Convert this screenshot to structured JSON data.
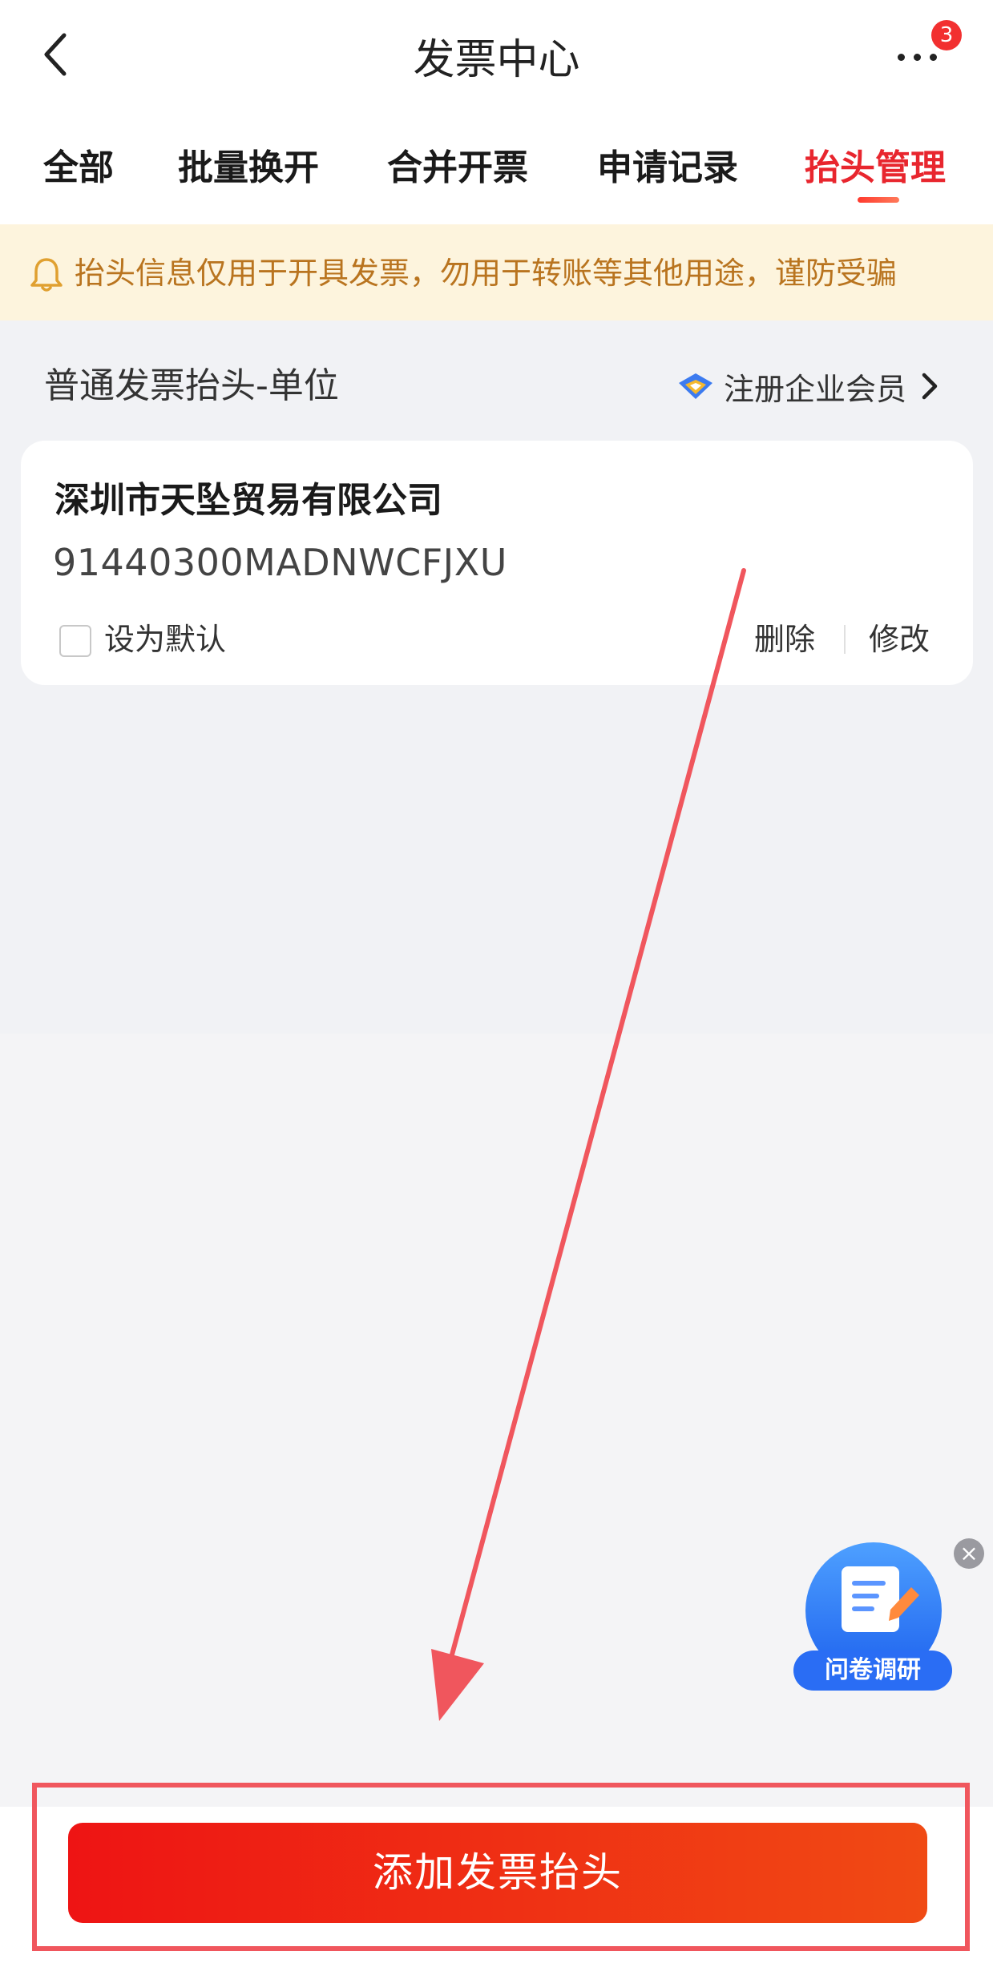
{
  "header": {
    "title": "发票中心",
    "notification_count": "3",
    "icons": {
      "back": "chevron-left-icon",
      "more": "more-dots-icon"
    }
  },
  "tabs": [
    {
      "label": "全部",
      "active": false
    },
    {
      "label": "批量换开",
      "active": false
    },
    {
      "label": "合并开票",
      "active": false
    },
    {
      "label": "申请记录",
      "active": false
    },
    {
      "label": "抬头管理",
      "active": true
    }
  ],
  "notice": {
    "icon": "bell-icon",
    "text": "抬头信息仅用于开具发票，勿用于转账等其他用途，谨防受骗",
    "color": "#b9741f",
    "background": "#fdf4dd"
  },
  "section": {
    "title": "普通发票抬头-单位",
    "enterprise_link": "注册企业会员"
  },
  "invoice_card": {
    "company_name": "深圳市天坠贸易有限公司",
    "tax_id": "91440300MADNWCFJXU",
    "set_default_label": "设为默认",
    "set_default_checked": false,
    "delete_label": "删除",
    "edit_label": "修改"
  },
  "survey_widget": {
    "label": "问卷调研",
    "close_glyph": "×"
  },
  "footer": {
    "add_button_label": "添加发票抬头"
  },
  "colors": {
    "accent": "#e8262e",
    "button_gradient_start": "#ee1414",
    "button_gradient_end": "#f04a14",
    "annotation": "#f0565d"
  }
}
